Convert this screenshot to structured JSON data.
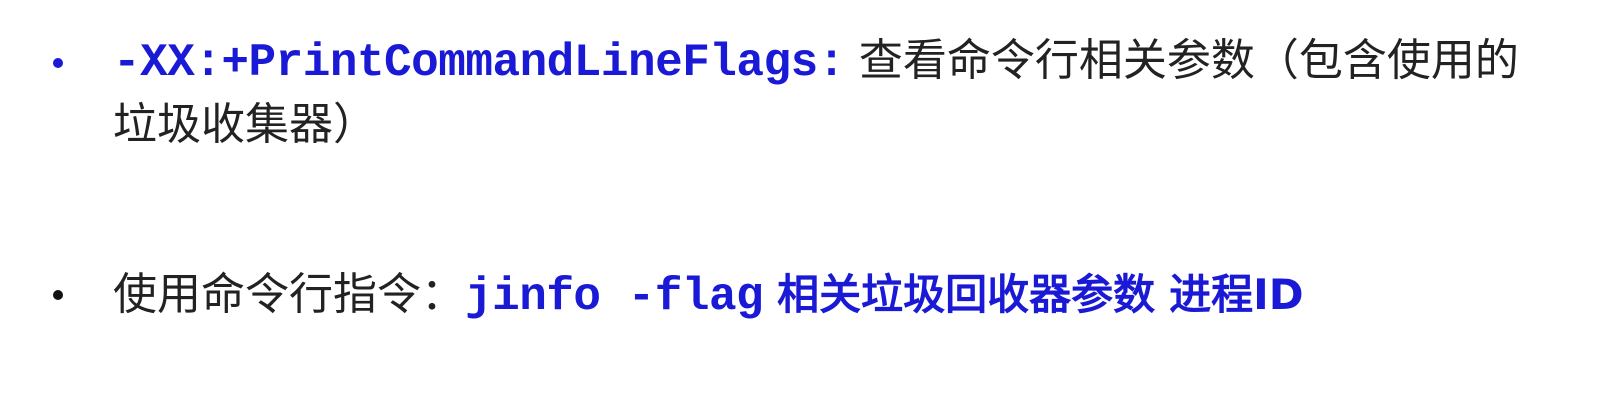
{
  "colors": {
    "body_text": "#222222",
    "accent_blue": "#1a1ad6",
    "bullet_1": "#1a1ad6",
    "bullet_2": "#111111",
    "background": "#ffffff"
  },
  "bullets": [
    {
      "flag": "-XX:+PrintCommandLineFlags:",
      "description": "查看命令行相关参数（包含使用的垃圾收集器）"
    },
    {
      "prefix": "使用命令行指令：",
      "command": "jinfo -flag",
      "arg1": "相关垃圾回收器参数",
      "arg2": "进程ID"
    }
  ]
}
